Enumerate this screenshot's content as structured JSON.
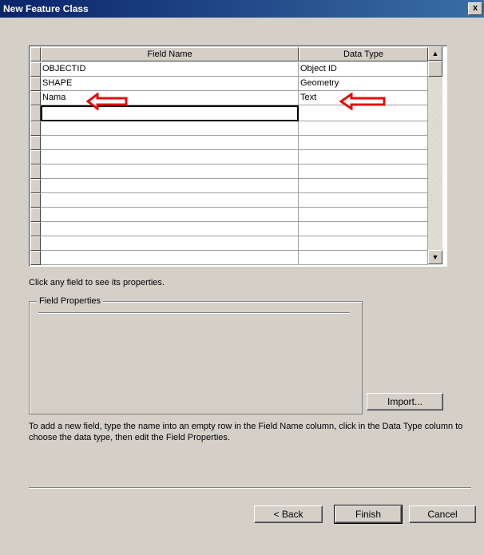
{
  "window": {
    "title": "New Feature Class",
    "close_glyph": "x"
  },
  "grid": {
    "columns": [
      "Field Name",
      "Data Type"
    ],
    "rows": [
      {
        "field_name": "OBJECTID",
        "data_type": "Object ID"
      },
      {
        "field_name": "SHAPE",
        "data_type": "Geometry"
      },
      {
        "field_name": "Nama",
        "data_type": "Text"
      },
      {
        "field_name": "",
        "data_type": ""
      }
    ],
    "empty_row_count": 10,
    "scroll_up_glyph": "▲",
    "scroll_down_glyph": "▼"
  },
  "annotations": {
    "arrow_color": "#e01010"
  },
  "hint_text": "Click any field to see its properties.",
  "field_properties": {
    "legend": "Field Properties"
  },
  "buttons": {
    "import": "Import...",
    "back": "< Back",
    "finish": "Finish",
    "cancel": "Cancel"
  },
  "info_text": "To add a new field, type the name into an empty row in the Field Name column, click in the Data Type column to choose the data type, then edit the Field Properties."
}
